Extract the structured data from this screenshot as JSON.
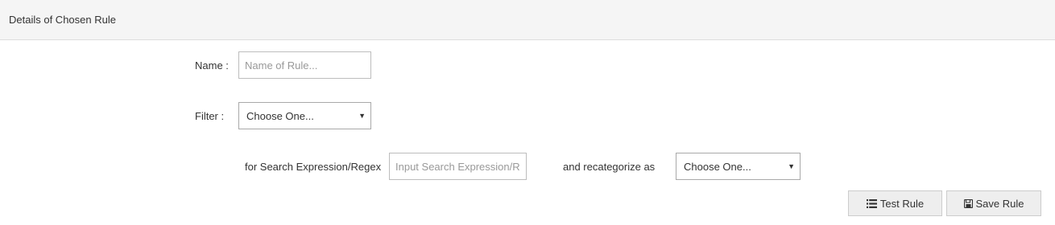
{
  "header": {
    "title": "Details of Chosen Rule"
  },
  "form": {
    "name_label": "Name :",
    "name_placeholder": "Name of Rule...",
    "filter_label": "Filter :",
    "filter_value": "Choose One...",
    "search_label": "for Search Expression/Regex",
    "search_placeholder": "Input Search Expression/Regex...",
    "recategorize_label": "and recategorize as",
    "recategorize_value": "Choose One..."
  },
  "buttons": {
    "test_label": "Test Rule",
    "test_icon": "list-icon",
    "save_label": "Save Rule",
    "save_icon": "floppy-disk-icon"
  }
}
